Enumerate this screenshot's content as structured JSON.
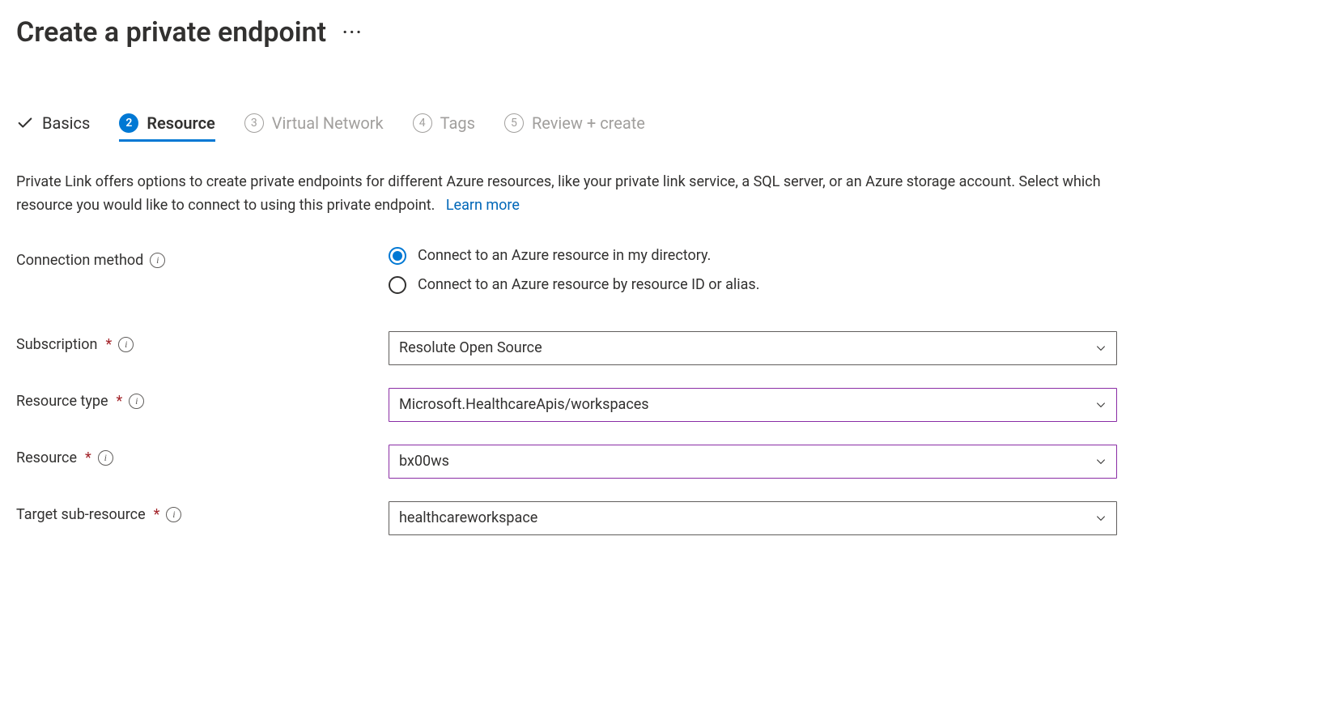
{
  "header": {
    "title": "Create a private endpoint"
  },
  "tabs": {
    "basics": "Basics",
    "resource": {
      "num": "2",
      "label": "Resource"
    },
    "vnet": {
      "num": "3",
      "label": "Virtual Network"
    },
    "tags": {
      "num": "4",
      "label": "Tags"
    },
    "review": {
      "num": "5",
      "label": "Review + create"
    }
  },
  "intro": {
    "text": "Private Link offers options to create private endpoints for different Azure resources, like your private link service, a SQL server, or an Azure storage account. Select which resource you would like to connect to using this private endpoint.",
    "learn_more": "Learn more"
  },
  "form": {
    "connection_method": {
      "label": "Connection method",
      "opt1": "Connect to an Azure resource in my directory.",
      "opt2": "Connect to an Azure resource by resource ID or alias."
    },
    "subscription": {
      "label": "Subscription",
      "value": "Resolute Open Source"
    },
    "resource_type": {
      "label": "Resource type",
      "value": "Microsoft.HealthcareApis/workspaces"
    },
    "resource": {
      "label": "Resource",
      "value": "bx00ws"
    },
    "target_sub_resource": {
      "label": "Target sub-resource",
      "value": "healthcareworkspace"
    }
  }
}
